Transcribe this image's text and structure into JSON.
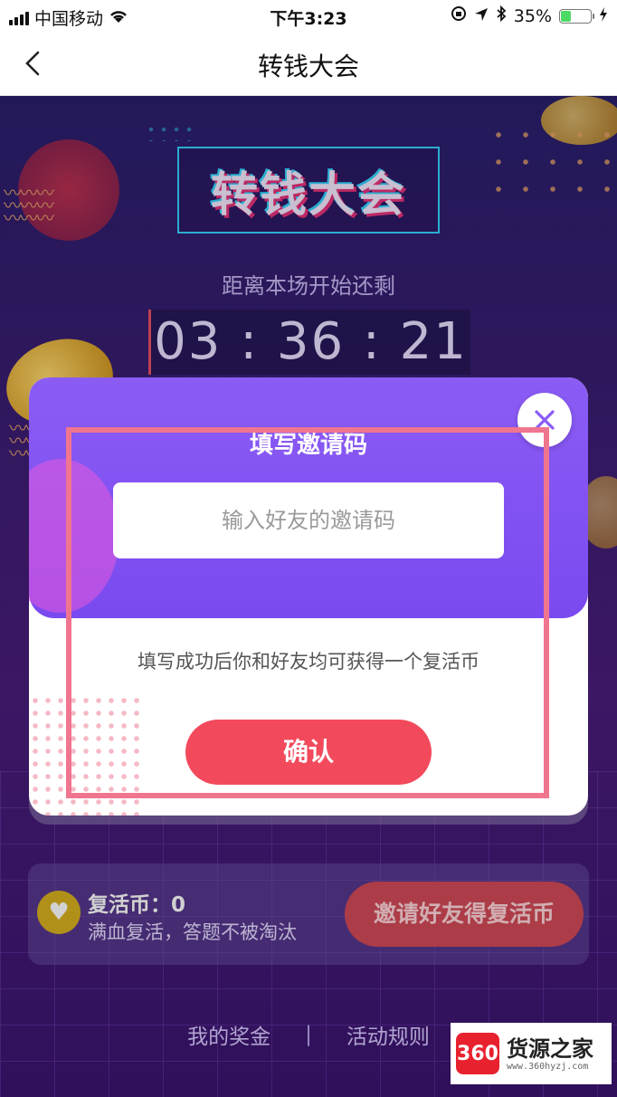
{
  "status_bar": {
    "carrier": "中国移动",
    "time": "下午3:23",
    "battery": "35%",
    "battery_level": 0.35
  },
  "nav": {
    "title": "转钱大会",
    "back_icon": "chevron-left-icon"
  },
  "page": {
    "logo_text": "转钱大会",
    "countdown_label": "距离本场开始还剩",
    "countdown": "03 : 36 : 21",
    "revive": {
      "title": "复活币：0",
      "subtitle": "满血复活，答题不被淘汰",
      "invite_button": "邀请好友得复活币"
    },
    "footer": {
      "my_bonus": "我的奖金",
      "separator": "|",
      "rules": "活动规则"
    }
  },
  "modal": {
    "title": "填写邀请码",
    "input_placeholder": "输入好友的邀请码",
    "input_value": "",
    "hint": "填写成功后你和好友均可获得一个复活币",
    "confirm_button": "确认",
    "close_icon": "close-icon"
  },
  "watermark": {
    "badge": "360",
    "name": "货源之家",
    "url": "www.360hyzj.com"
  },
  "colors": {
    "accent_purple": "#8b5cf4",
    "confirm_red": "#f24a5c",
    "highlight_pink": "#f0758f"
  }
}
